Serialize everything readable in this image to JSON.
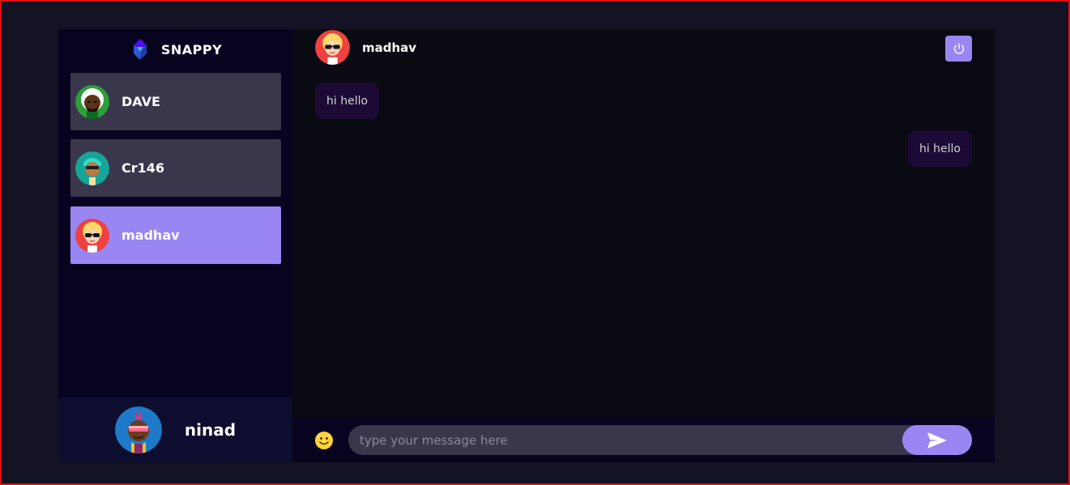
{
  "brand": {
    "name": "SNAPPY",
    "logo_icon": "snappy-logo-icon"
  },
  "contacts": [
    {
      "name": "DAVE",
      "avatar_icon": "avatar-dave-icon",
      "selected": false
    },
    {
      "name": "Cr146",
      "avatar_icon": "avatar-cr146-icon",
      "selected": false
    },
    {
      "name": "madhav",
      "avatar_icon": "avatar-madhav-icon",
      "selected": true
    }
  ],
  "current_user": {
    "name": "ninad",
    "avatar_icon": "avatar-ninad-icon"
  },
  "chat": {
    "header_name": "madhav",
    "logout_icon": "power-icon",
    "messages": [
      {
        "direction": "received",
        "text": "hi hello"
      },
      {
        "direction": "sent",
        "text": "hi hello"
      }
    ],
    "input": {
      "placeholder": "type your message here",
      "value": ""
    },
    "emoji_icon": "emoji-smiley-icon",
    "send_icon": "send-icon"
  },
  "colors": {
    "accent": "#9a86f3",
    "sidebar_bg": "#080420",
    "message_bg": "#1b0a36",
    "page_bg": "#131324"
  }
}
